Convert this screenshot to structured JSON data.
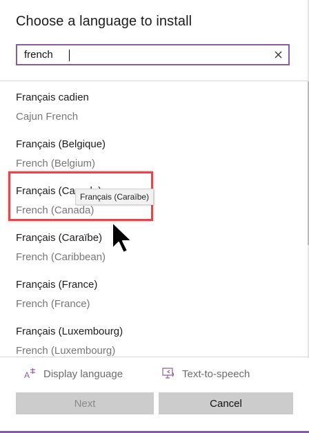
{
  "dialog": {
    "title": "Choose a language to install"
  },
  "search": {
    "value": "french",
    "clear_icon": "close-icon"
  },
  "languages": [
    {
      "native": "Français cadien",
      "english": "Cajun French"
    },
    {
      "native": "Français (Belgique)",
      "english": "French (Belgium)"
    },
    {
      "native": "Français (Canada)",
      "english": "French (Canada)"
    },
    {
      "native": "Français (Caraïbe)",
      "english": "French (Caribbean)"
    },
    {
      "native": "Français (France)",
      "english": "French (France)"
    },
    {
      "native": "Français (Luxembourg)",
      "english": "French (Luxembourg)"
    }
  ],
  "tooltip": {
    "text": "Français (Caraïbe)"
  },
  "features": {
    "display_language": {
      "label": "Display language",
      "icon": "display-language-icon"
    },
    "text_to_speech": {
      "label": "Text-to-speech",
      "icon": "text-to-speech-icon"
    }
  },
  "buttons": {
    "next": "Next",
    "cancel": "Cancel"
  },
  "colors": {
    "accent": "#8a5aa0",
    "highlight": "#e8444a",
    "button_bg": "#cccccc",
    "secondary_text": "#767676"
  }
}
